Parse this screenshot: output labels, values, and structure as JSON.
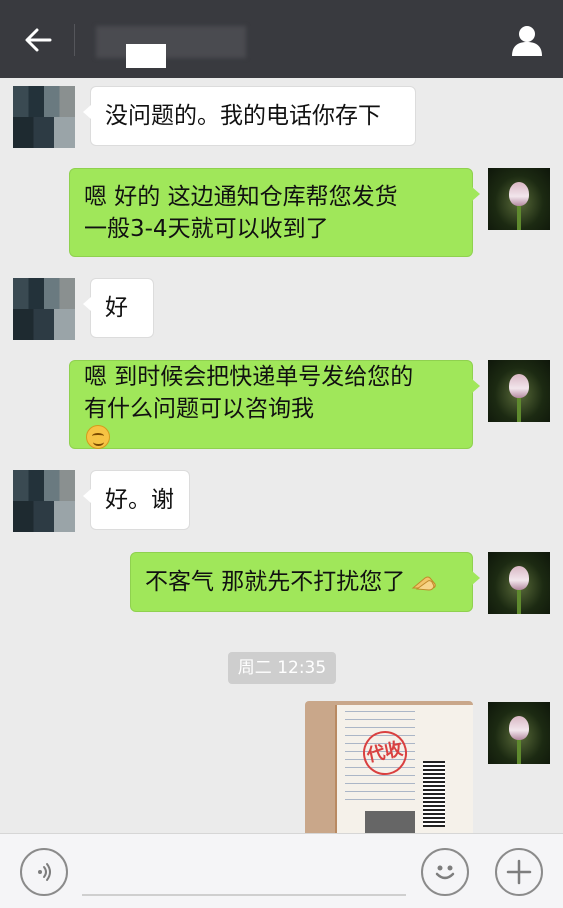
{
  "header": {
    "back_icon": "back-arrow-icon",
    "profile_icon": "person-icon"
  },
  "messages": [
    {
      "side": "left",
      "lines": [
        "没问题的。我的电话你存下"
      ]
    },
    {
      "side": "right",
      "lines": [
        "嗯 好的  这边通知仓库帮您发货",
        "一般3-4天就可以收到了"
      ]
    },
    {
      "side": "left",
      "lines": [
        "好"
      ]
    },
    {
      "side": "right",
      "lines": [
        "嗯 到时候会把快递单号发给您的",
        "有什么问题可以咨询我"
      ],
      "emoji": "smile-emoji"
    },
    {
      "side": "left",
      "lines": [
        "好。谢"
      ]
    },
    {
      "side": "right",
      "lines": [
        "不客气 那就先不打扰您了"
      ],
      "emoji": "clap-hand-emoji"
    }
  ],
  "timestamp": "周二 12:35",
  "photo": {
    "stamp_text": "代收"
  },
  "bottom_bar": {
    "voice_icon": "voice-icon",
    "emoji_icon": "emoji-icon",
    "plus_icon": "plus-icon"
  },
  "colors": {
    "header_bg": "#393a3f",
    "chat_bg": "#ebebeb",
    "sent_bubble": "#a0e75a",
    "received_bubble": "#ffffff"
  }
}
